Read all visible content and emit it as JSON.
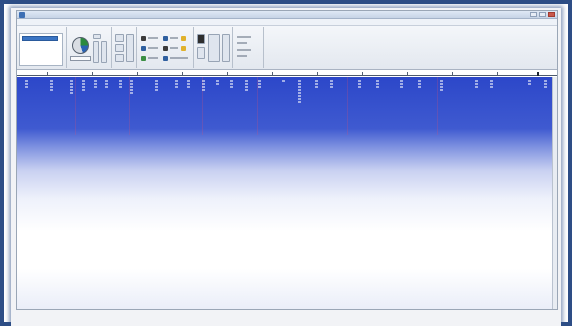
{
  "window": {
    "title": ""
  },
  "menu": {
    "items": [
      "",
      "",
      "",
      "",
      ""
    ]
  },
  "ribbon": {
    "group_labels": [
      "",
      "",
      "",
      "",
      "",
      ""
    ]
  },
  "ruler": {
    "ticks": [
      "",
      "",
      "",
      "",
      "",
      "",
      "",
      "",
      "",
      "",
      ""
    ]
  },
  "document": {
    "column_headers": [
      "",
      "",
      "",
      "",
      "",
      "",
      "",
      "",
      "",
      "",
      "",
      "",
      "",
      "",
      "",
      "",
      "",
      "",
      "",
      "",
      "",
      "",
      "",
      "",
      "",
      "",
      "",
      ""
    ]
  },
  "colors": {
    "frame": "#2e4e86",
    "doc_band": "#2c47c9",
    "selection": "#3b75c4"
  }
}
